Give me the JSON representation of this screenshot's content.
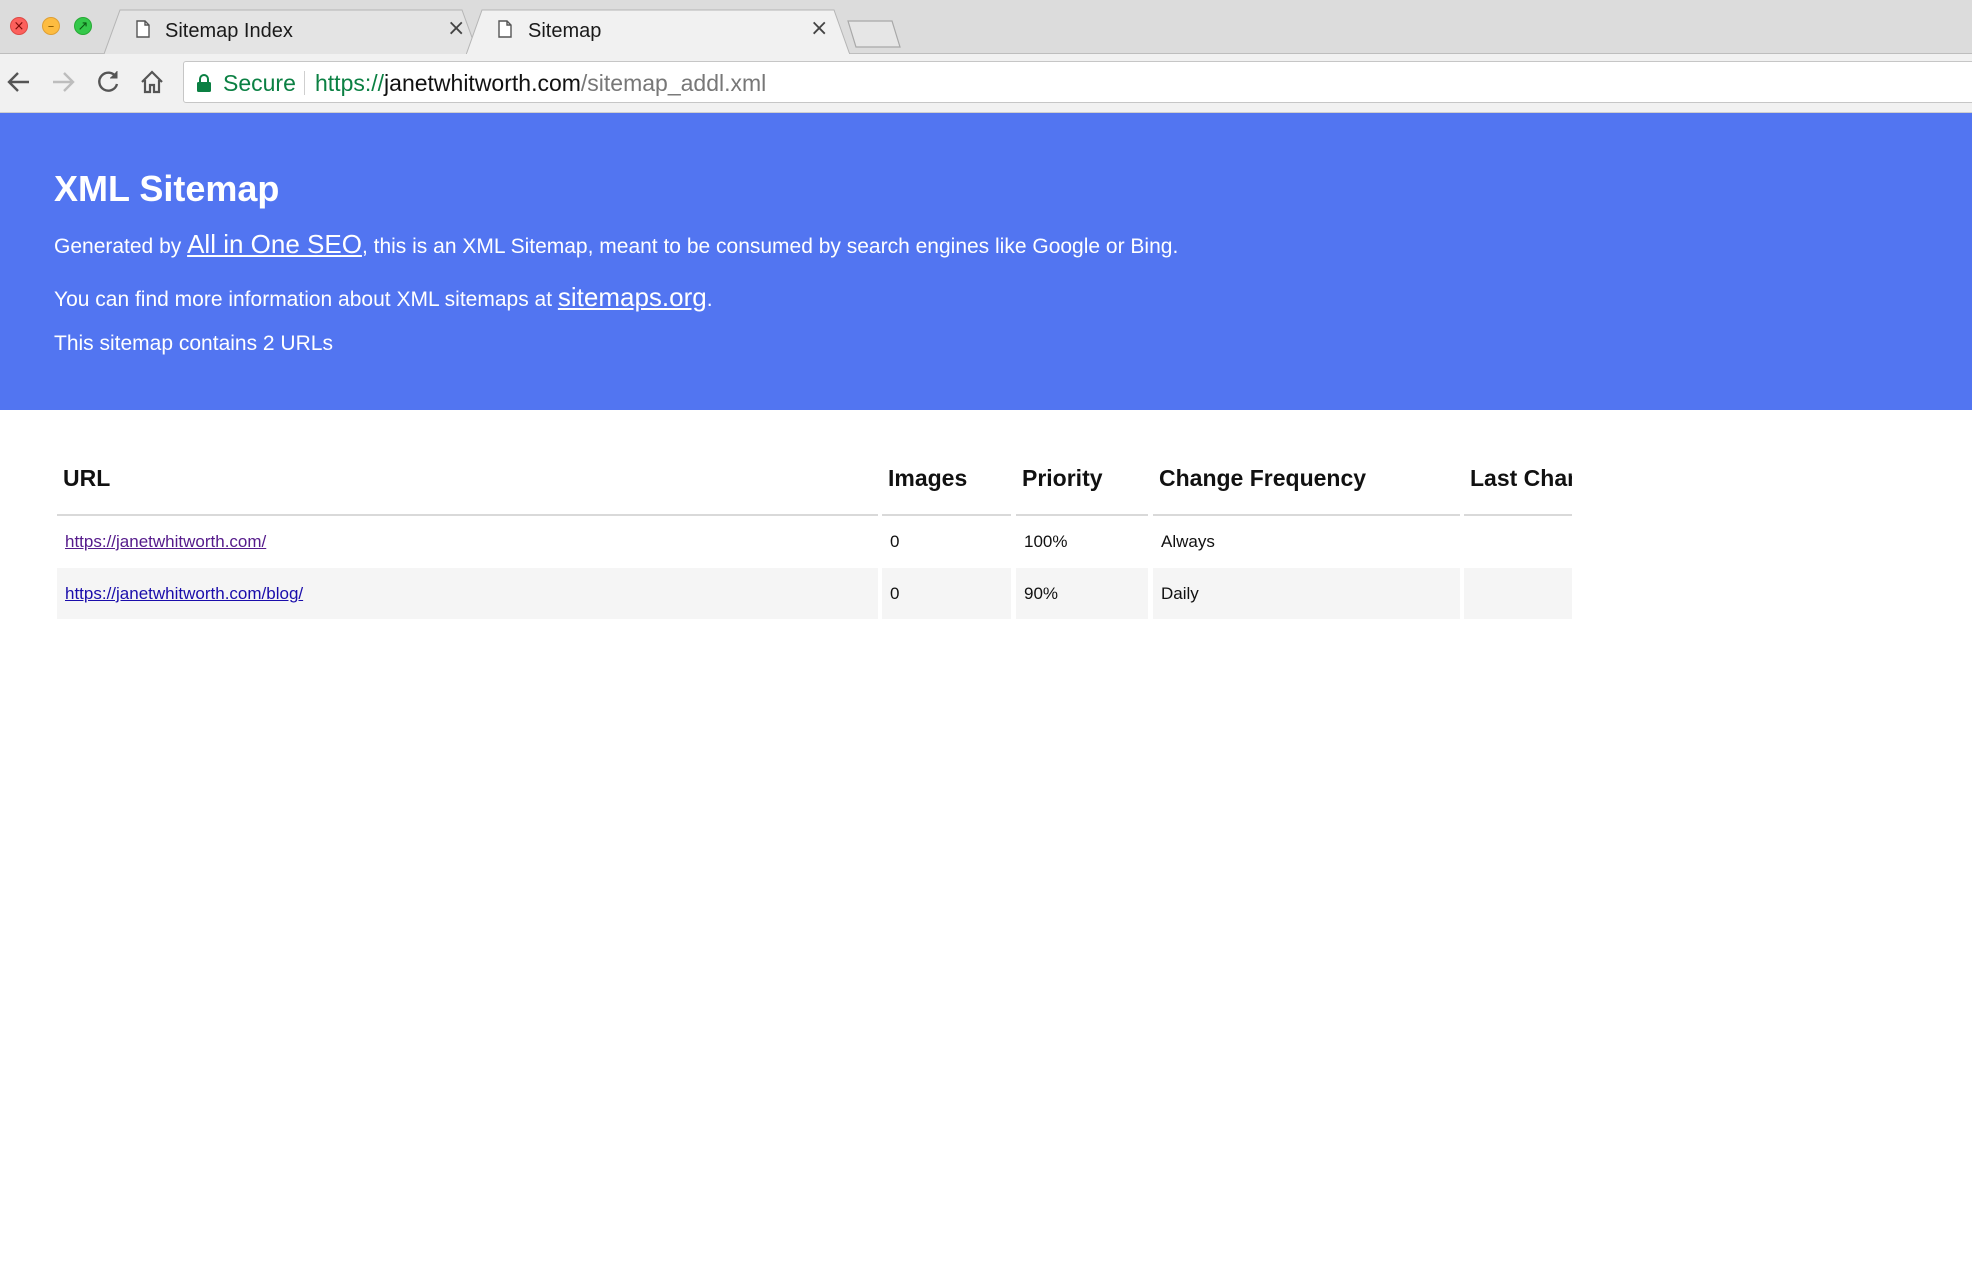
{
  "browser": {
    "tabs": [
      {
        "title": "Sitemap Index",
        "active": false
      },
      {
        "title": "Sitemap",
        "active": true
      }
    ],
    "address": {
      "secure_label": "Secure",
      "scheme": "https://",
      "host": "janetwhitworth.com",
      "path": "/sitemap_addl.xml"
    }
  },
  "header": {
    "title": "XML Sitemap",
    "generated_prefix": "Generated by ",
    "generator_link": "All in One SEO",
    "generated_suffix": ", this is an XML Sitemap, meant to be consumed by search engines like Google or Bing.",
    "info_prefix": "You can find more information about XML sitemaps at ",
    "info_link": "sitemaps.org",
    "info_suffix": ".",
    "count_text": "This sitemap contains 2 URLs"
  },
  "table": {
    "columns": [
      "URL",
      "Images",
      "Priority",
      "Change Frequency",
      "Last Change"
    ],
    "rows": [
      {
        "url": "https://janetwhitworth.com/",
        "images": "0",
        "priority": "100%",
        "frequency": "Always",
        "last_change": ""
      },
      {
        "url": "https://janetwhitworth.com/blog/",
        "images": "0",
        "priority": "90%",
        "frequency": "Daily",
        "last_change": ""
      }
    ]
  },
  "colors": {
    "banner": "#5275f1",
    "secure_green": "#0b8043",
    "link": "#1a0dab",
    "visited_link": "#551a8b"
  },
  "icons": [
    "close-window-icon",
    "minimize-window-icon",
    "fullscreen-window-icon",
    "document-icon",
    "tab-close-icon",
    "back-arrow-icon",
    "forward-arrow-icon",
    "reload-icon",
    "home-icon",
    "lock-icon"
  ]
}
